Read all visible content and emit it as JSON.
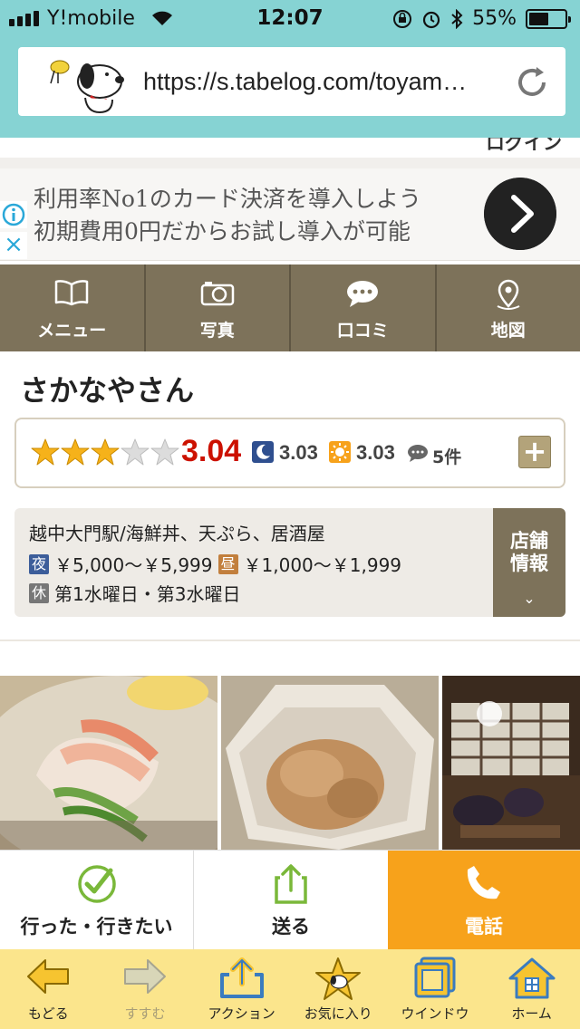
{
  "status_bar": {
    "carrier": "Y!mobile",
    "time": "12:07",
    "battery": "55%",
    "battery_level": 0.55
  },
  "browser": {
    "url": "https://s.tabelog.com/toyam…"
  },
  "page": {
    "login_partial": "ログイン"
  },
  "ad": {
    "line1": "利用率No1のカード決済を導入しよう",
    "line2": "初期費用0円だからお試し導入が可能",
    "close_icon": "×"
  },
  "nav": {
    "tabs": [
      {
        "label": "メニュー",
        "icon": "book-icon"
      },
      {
        "label": "写真",
        "icon": "camera-icon"
      },
      {
        "label": "口コミ",
        "icon": "speech-bubble-icon"
      },
      {
        "label": "地図",
        "icon": "map-pin-icon"
      }
    ]
  },
  "restaurant": {
    "name": "さかなやさん",
    "rating": "3.04",
    "stars_filled": 3,
    "stars_total": 5,
    "night_rating": "3.03",
    "lunch_rating": "3.03",
    "review_count": "5件",
    "plus_label": "+",
    "genre": "越中大門駅/海鮮丼、天ぷら、居酒屋",
    "night_tag": "夜",
    "night_price": "￥5,000～￥5,999",
    "lunch_tag": "昼",
    "lunch_price": "￥1,000～￥1,999",
    "holiday_tag": "休",
    "holiday": "第1水曜日・第3水曜日",
    "store_info_label_1": "店舗",
    "store_info_label_2": "情報",
    "store_info_chevron": "⌄"
  },
  "actions": {
    "went": "行った・行きたい",
    "send": "送る",
    "phone": "電話"
  },
  "toolbar": {
    "back": "もどる",
    "forward": "すすむ",
    "action": "アクション",
    "favorite": "お気に入り",
    "window": "ウインドウ",
    "home": "ホーム"
  },
  "colors": {
    "chrome": "#86d3d3",
    "nav": "#7d725a",
    "rating_red": "#cc1100",
    "phone_orange": "#f7a21b",
    "toolbar_yellow": "#fbe58c"
  }
}
